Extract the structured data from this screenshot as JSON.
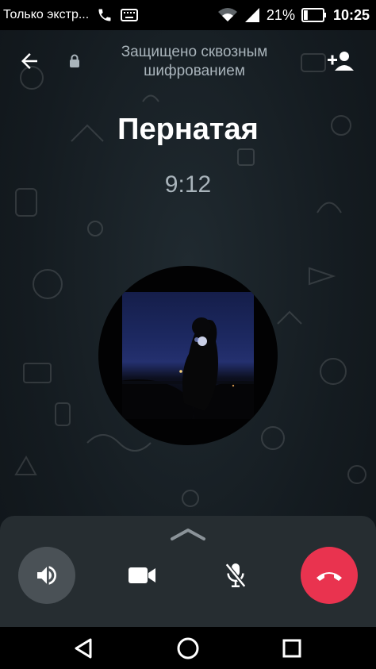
{
  "status_bar": {
    "carrier": "Только экстр...",
    "battery_percent": "21%",
    "time": "10:25",
    "battery_level": 0.21,
    "icons": [
      "phone-icon",
      "keyboard-icon",
      "wifi-icon",
      "signal-icon",
      "battery-icon"
    ]
  },
  "header": {
    "encryption_text": "Защищено сквозным шифрованием",
    "back_icon": "arrow-left-icon",
    "lock_icon": "lock-icon",
    "add_icon": "add-person-icon"
  },
  "call": {
    "contact_name": "Пернатая",
    "timer": "9:12"
  },
  "controls": {
    "expand_icon": "chevron-up-icon",
    "buttons": [
      {
        "name": "speaker",
        "icon": "speaker-icon",
        "active": true
      },
      {
        "name": "video",
        "icon": "video-camera-icon",
        "active": false
      },
      {
        "name": "mute",
        "icon": "mic-off-icon",
        "active": false
      },
      {
        "name": "end-call",
        "icon": "hangup-icon",
        "color": "#e9334f"
      }
    ]
  },
  "nav_bar": {
    "icons": [
      "back-triangle-icon",
      "home-circle-icon",
      "recents-square-icon"
    ]
  },
  "colors": {
    "background": "#141b20",
    "panel": "#262d31",
    "end_call": "#e9334f",
    "secondary_text": "#a9b4bb"
  }
}
